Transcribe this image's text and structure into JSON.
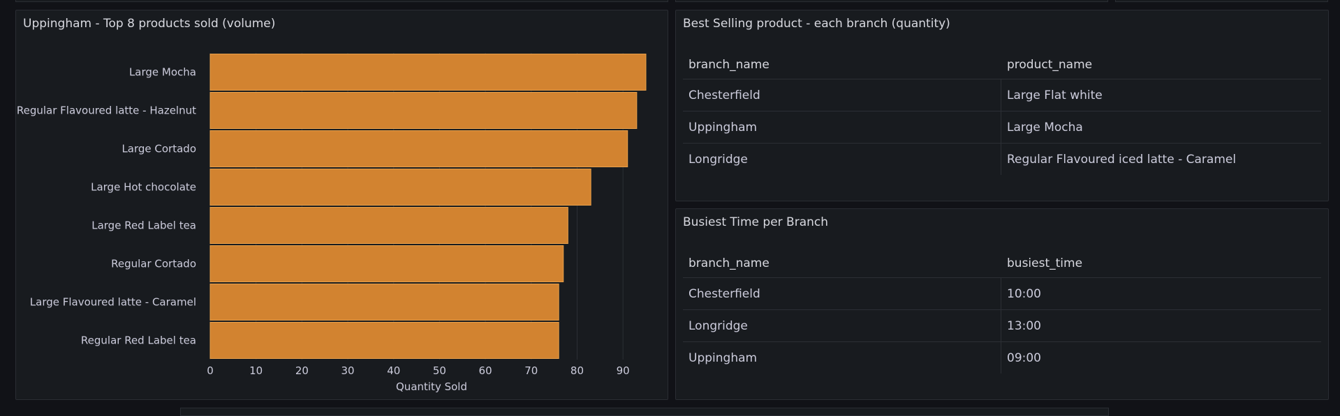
{
  "colors": {
    "background": "#111217",
    "panel": "#181b1f",
    "bar_fill": "#d28330",
    "bar_stroke": "#e8a04a",
    "text": "#ccccdc"
  },
  "panels": {
    "products": {
      "title": "Uppingham - Top 8 products sold (volume)"
    },
    "best_selling": {
      "title": "Best Selling product - each branch (quantity)",
      "columns": [
        "branch_name",
        "product_name"
      ],
      "rows": [
        [
          "Chesterfield",
          "Large Flat white"
        ],
        [
          "Uppingham",
          "Large Mocha"
        ],
        [
          "Longridge",
          "Regular Flavoured iced latte - Caramel"
        ]
      ]
    },
    "busiest_time": {
      "title": "Busiest Time per Branch",
      "columns": [
        "branch_name",
        "busiest_time"
      ],
      "rows": [
        [
          "Chesterfield",
          "10:00"
        ],
        [
          "Longridge",
          "13:00"
        ],
        [
          "Uppingham",
          "09:00"
        ]
      ]
    }
  },
  "chart_data": {
    "type": "bar",
    "orientation": "horizontal",
    "title": "Uppingham - Top 8 products sold (volume)",
    "xlabel": "Quantity Sold",
    "ylabel": "",
    "categories": [
      "Large Mocha",
      "Regular Flavoured latte - Hazelnut",
      "Large Cortado",
      "Large Hot chocolate",
      "Large Red Label tea",
      "Regular Cortado",
      "Large Flavoured latte - Caramel",
      "Regular Red Label tea"
    ],
    "values": [
      95,
      93,
      91,
      83,
      78,
      77,
      76,
      76
    ],
    "xlim": [
      0,
      95
    ],
    "xticks": [
      0,
      10,
      20,
      30,
      40,
      50,
      60,
      70,
      80,
      90
    ],
    "grid": true,
    "legend": "none"
  }
}
